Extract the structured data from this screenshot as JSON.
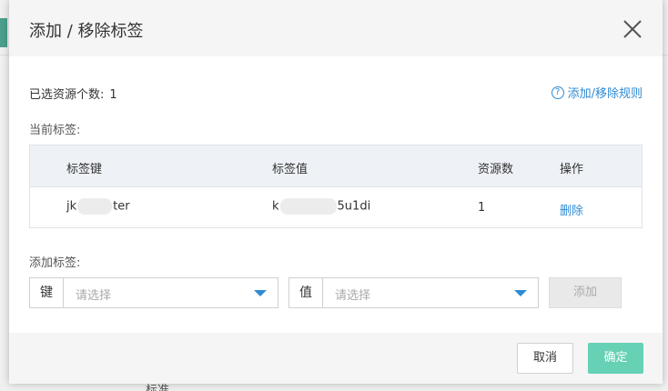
{
  "background": {
    "partial_text": "标准"
  },
  "dialog": {
    "title": "添加 / 移除标签",
    "close_icon": "close-icon",
    "selected_count_label": "已选资源个数:",
    "selected_count_value": "1",
    "rule_link": "添加/移除规则",
    "rule_icon": "help-circle-icon",
    "current_tags_label": "当前标签:",
    "table": {
      "headers": [
        "标签键",
        "标签值",
        "资源数",
        "操作"
      ],
      "rows": [
        {
          "key_start": "jk",
          "key_end": "ter",
          "value_start": "k",
          "value_end": "5u1di",
          "count": "1",
          "action": "删除"
        }
      ]
    },
    "add_tags_label": "添加标签:",
    "key_select": {
      "prefix": "键",
      "placeholder": "请选择"
    },
    "value_select": {
      "prefix": "值",
      "placeholder": "请选择"
    },
    "add_button": "添加",
    "cancel_button": "取消",
    "ok_button": "确定"
  },
  "colors": {
    "link": "#2f8bd4",
    "primary": "#66d1b5",
    "header_bg": "#f5f5f5",
    "table_header_bg": "#eef2f6"
  }
}
